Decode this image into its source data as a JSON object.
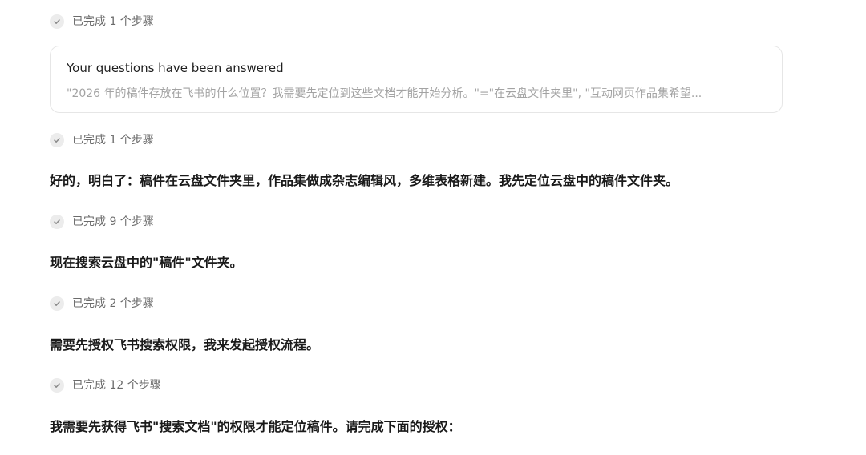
{
  "icons": {
    "step_status": "check-circle-icon"
  },
  "colors": {
    "text_primary": "#1a1a1a",
    "text_muted": "#6b6b6b",
    "text_summary": "#a3a3a3",
    "card_border": "#e6e6e6",
    "check_bg": "#ececec"
  },
  "timeline": {
    "step1": {
      "label": "已完成 1 个步骤"
    },
    "answer_card": {
      "title": "Your questions have been answered",
      "summary": "\"2026 年的稿件存放在飞书的什么位置？我需要先定位到这些文档才能开始分析。\"=\"在云盘文件夹里\", \"互动网页作品集希望..."
    },
    "step2": {
      "label": "已完成 1 个步骤"
    },
    "message1": "好的，明白了：稿件在云盘文件夹里，作品集做成杂志编辑风，多维表格新建。我先定位云盘中的稿件文件夹。",
    "step3": {
      "label": "已完成 9 个步骤"
    },
    "message2": "现在搜索云盘中的\"稿件\"文件夹。",
    "step4": {
      "label": "已完成 2 个步骤"
    },
    "message3": "需要先授权飞书搜索权限，我来发起授权流程。",
    "step5": {
      "label": "已完成 12 个步骤"
    },
    "message4": "我需要先获得飞书\"搜索文档\"的权限才能定位稿件。请完成下面的授权："
  }
}
